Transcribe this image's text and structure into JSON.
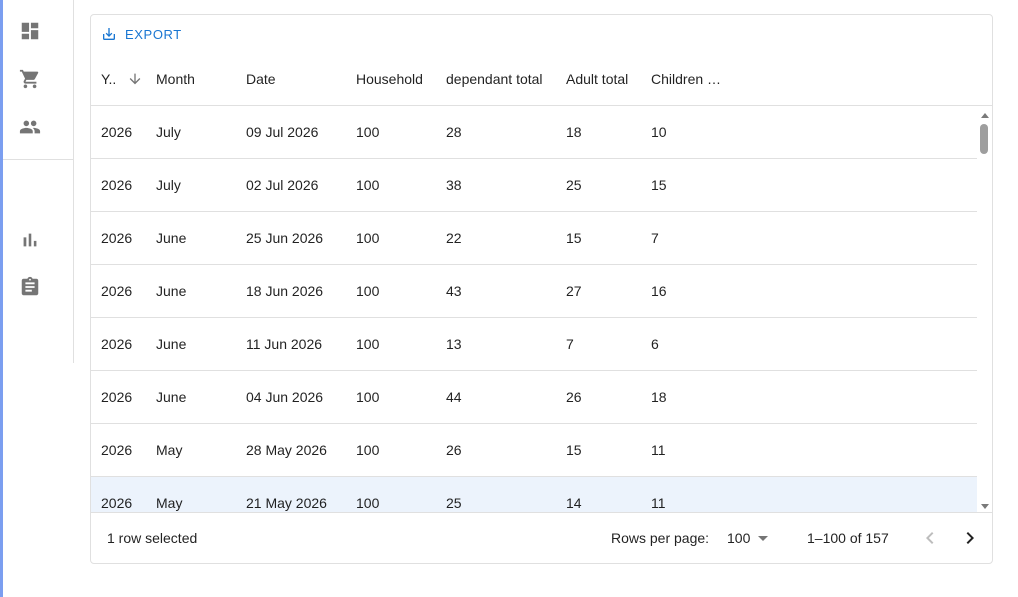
{
  "sidebar": {
    "items": [
      {
        "icon": "dashboard-icon"
      },
      {
        "icon": "shopping-cart-icon"
      },
      {
        "icon": "people-icon"
      },
      {
        "icon": "bar-chart-icon"
      },
      {
        "icon": "clipboard-icon"
      }
    ]
  },
  "toolbar": {
    "export_label": "EXPORT"
  },
  "grid": {
    "columns": [
      "Y..",
      "Month",
      "Date",
      "Household",
      "dependant total",
      "Adult total",
      "Children …"
    ],
    "sort": {
      "column": "Year",
      "direction": "descending",
      "icon": "arrow-down-icon"
    },
    "rows": [
      {
        "year": "2026",
        "month": "July",
        "date": "09 Jul 2026",
        "household": "100",
        "dependant": "28",
        "adult": "18",
        "children": "10",
        "selected": false
      },
      {
        "year": "2026",
        "month": "July",
        "date": "02 Jul 2026",
        "household": "100",
        "dependant": "38",
        "adult": "25",
        "children": "15",
        "selected": false
      },
      {
        "year": "2026",
        "month": "June",
        "date": "25 Jun 2026",
        "household": "100",
        "dependant": "22",
        "adult": "15",
        "children": "7",
        "selected": false
      },
      {
        "year": "2026",
        "month": "June",
        "date": "18 Jun 2026",
        "household": "100",
        "dependant": "43",
        "adult": "27",
        "children": "16",
        "selected": false
      },
      {
        "year": "2026",
        "month": "June",
        "date": "11 Jun 2026",
        "household": "100",
        "dependant": "13",
        "adult": "7",
        "children": "6",
        "selected": false
      },
      {
        "year": "2026",
        "month": "June",
        "date": "04 Jun 2026",
        "household": "100",
        "dependant": "44",
        "adult": "26",
        "children": "18",
        "selected": false
      },
      {
        "year": "2026",
        "month": "May",
        "date": "28 May 2026",
        "household": "100",
        "dependant": "26",
        "adult": "15",
        "children": "11",
        "selected": false
      },
      {
        "year": "2026",
        "month": "May",
        "date": "21 May 2026",
        "household": "100",
        "dependant": "25",
        "adult": "14",
        "children": "11",
        "selected": true
      }
    ]
  },
  "footer": {
    "selected_text": "1 row selected",
    "rows_per_page_label": "Rows per page:",
    "rows_per_page_value": "100",
    "page_info": "1–100 of 157"
  },
  "colors": {
    "accent": "#1976d2",
    "selected_row": "#ecf3fc",
    "left_accent": "#7b9ef0"
  }
}
